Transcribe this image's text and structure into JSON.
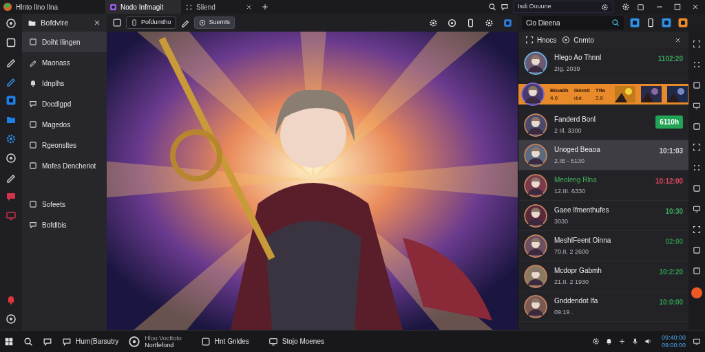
{
  "title_bar": {
    "app_title": "Hlnto Ilno Ilna",
    "tabs": [
      {
        "label": "Nodo Infmagit",
        "selected": true
      },
      {
        "label": "Sliend",
        "selected": false
      }
    ],
    "search": {
      "value": "Isdi Oouune"
    }
  },
  "sidebar": {
    "title": "Bofdvlre",
    "items": [
      {
        "label": "Doiht Ilingen",
        "selected": true
      },
      {
        "label": "Maonass",
        "selected": false
      },
      {
        "label": "Idnplhs",
        "selected": false
      },
      {
        "label": "Docdlgpd",
        "selected": false
      },
      {
        "label": "Magedos",
        "selected": false
      },
      {
        "label": "Rgeonsltes",
        "selected": false
      },
      {
        "label": "Mofes Dencheriot",
        "selected": false
      }
    ],
    "bottom_items": [
      {
        "label": "Sofeets",
        "selected": false
      },
      {
        "label": "Bofdlbis",
        "selected": false
      }
    ]
  },
  "toolbar": {
    "buttons": [
      {
        "label": "Pofdumtho"
      },
      {
        "label": "Suemts"
      }
    ]
  },
  "chat_panel": {
    "search": {
      "value": "Clo Dieena"
    },
    "header_tabs": [
      "Hnocs",
      "Cnmto"
    ],
    "items": [
      {
        "kind": "chat",
        "name": "Hlego Ao Thnnl",
        "subtitle": "2Ig. 2039",
        "time": "1102:20",
        "color": "#3aa55a",
        "badge": false,
        "highlighted": false,
        "selected": false
      },
      {
        "kind": "banner",
        "stats": [
          {
            "label": "Bloa8h",
            "value": "4.6"
          },
          {
            "label": "Gmnit",
            "value": "dut."
          },
          {
            "label": "Tfla",
            "value": "3.6"
          }
        ],
        "thumbnails": [
          {
            "kind": "picture"
          },
          {
            "kind": "picture"
          },
          {
            "kind": "picture"
          }
        ]
      },
      {
        "kind": "chat",
        "name": "Fanderd Bonl",
        "subtitle": "2 IIl. 3300",
        "time": "6110h",
        "color": "#22a355",
        "badge": true,
        "highlighted": false,
        "selected": false
      },
      {
        "kind": "chat",
        "name": "Unoged Beaoa",
        "subtitle": "2.IB - 5130",
        "time": "10:1:03",
        "color": "#d4d4d8",
        "badge": false,
        "highlighted": false,
        "selected": true
      },
      {
        "kind": "chat",
        "name": "Meoleng Rlna",
        "subtitle": "12.III. 6330",
        "time": "10:12:00",
        "color": "#e0455f",
        "badge": false,
        "highlighted": true,
        "selected": false
      },
      {
        "kind": "chat",
        "name": "Gaee Ifmenthufes",
        "subtitle": "3030",
        "time": "10:30",
        "color": "#3aa55a",
        "badge": false,
        "highlighted": false,
        "selected": false
      },
      {
        "kind": "chat",
        "name": "MeshIFeent Oinna",
        "subtitle": "70.II. 2 2600",
        "time": "02:00",
        "color": "#2f8a4a",
        "badge": false,
        "highlighted": false,
        "selected": false
      },
      {
        "kind": "chat",
        "name": "Mcdopr Gabmh",
        "subtitle": "21.II. 2 1930",
        "time": "10:2:20",
        "color": "#2f9a4f",
        "badge": false,
        "highlighted": false,
        "selected": false
      },
      {
        "kind": "chat",
        "name": "Gnddendot Ifa",
        "subtitle": "09:19 .",
        "time": "10:0:00",
        "color": "#2f9a4f",
        "badge": false,
        "highlighted": false,
        "selected": false
      }
    ]
  },
  "taskbar": {
    "items": [
      {
        "label": "Hurn(Barsutry"
      },
      {
        "label": "Hloo Vocttoto",
        "sublabel": "Nortfefond"
      },
      {
        "label": "Hnt Gnldes"
      },
      {
        "label": "Stojo Moenes"
      }
    ],
    "clock": {
      "time": "09:40:00",
      "date": "09:00:00"
    }
  }
}
